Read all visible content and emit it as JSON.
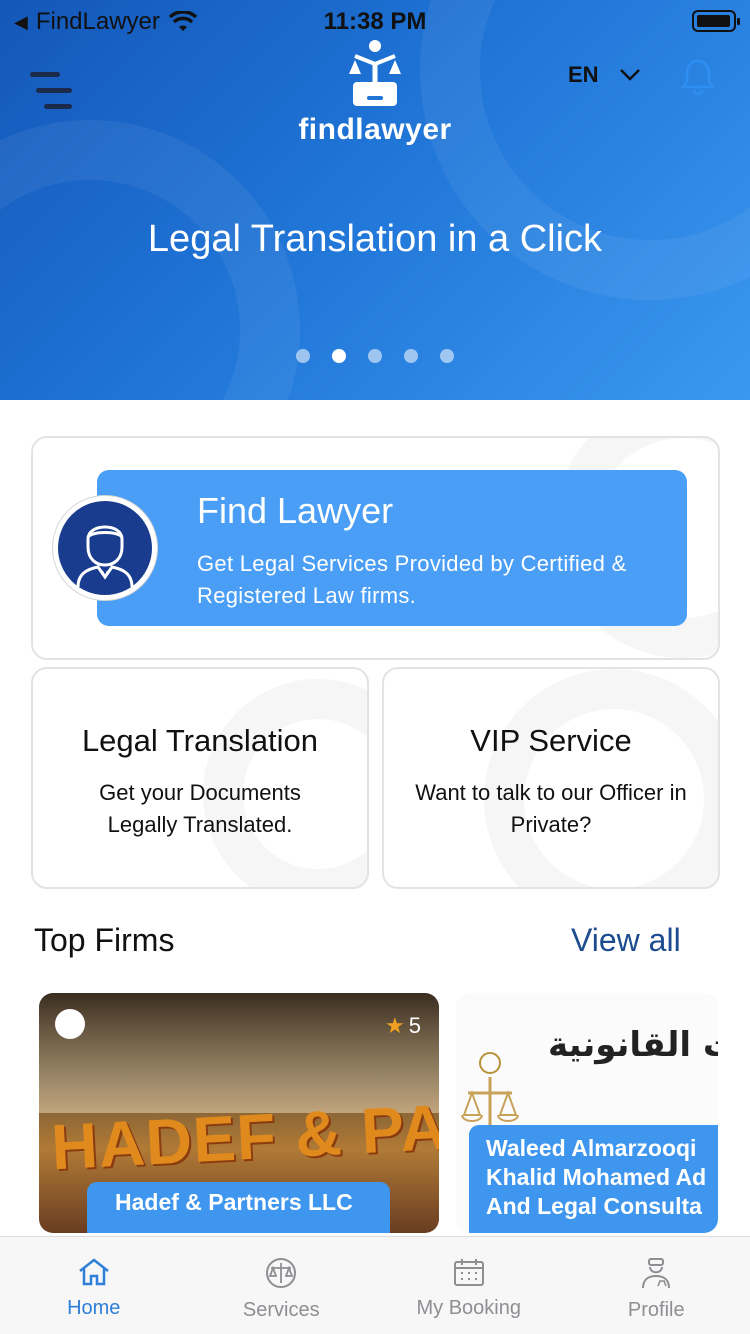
{
  "status_bar": {
    "carrier": "FindLawyer",
    "time": "11:38 PM"
  },
  "header": {
    "logo_text": "findlawyer",
    "language": "EN"
  },
  "hero": {
    "title": "Legal Translation in a Click",
    "slides_count": 5,
    "active_slide": 2
  },
  "find_lawyer": {
    "title": "Find Lawyer",
    "description": "Get Legal Services Provided by Certified & Registered Law firms."
  },
  "legal_translation": {
    "title": "Legal Translation",
    "description": "Get your Documents Legally Translated."
  },
  "vip_service": {
    "title": "VIP Service",
    "description": "Want to talk to our Officer in Private?"
  },
  "top_firms": {
    "title": "Top Firms",
    "view_all": "View all",
    "firms": [
      {
        "name": "Hadef & Partners LLC",
        "rating": "5",
        "image_text": "HADEF & PARTNERS"
      },
      {
        "name": "Waleed Almarzooqi Khalid Mohamed Ad And Legal Consulta",
        "image_text": "للمحاماة والاستشارات القانونية"
      }
    ]
  },
  "tabs": [
    {
      "label": "Home",
      "icon": "home-icon",
      "active": true
    },
    {
      "label": "Services",
      "icon": "scales-icon",
      "active": false
    },
    {
      "label": "My Booking",
      "icon": "calendar-icon",
      "active": false
    },
    {
      "label": "Profile",
      "icon": "lawyer-profile-icon",
      "active": false
    }
  ],
  "colors": {
    "brand_blue": "#1f74d6",
    "card_blue": "#4a9ef5",
    "tab_active": "#2f7fd8",
    "link": "#1d4b8f"
  }
}
